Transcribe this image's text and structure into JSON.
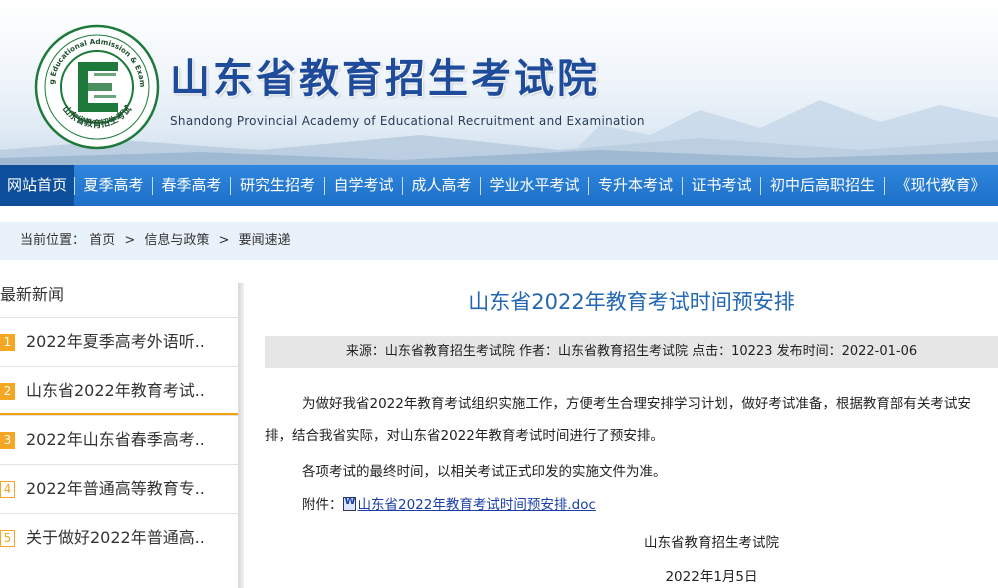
{
  "header": {
    "site_title": "山东省教育招生考试院",
    "site_subtitle": "Shandong Provincial Academy of Educational Recruitment and Examination",
    "logo_ring_text": "Shandong Educational Admission & Examinations",
    "logo_cn_text": "山东省教育招生考试"
  },
  "nav": {
    "items": [
      {
        "label": "网站首页",
        "active": true
      },
      {
        "label": "夏季高考"
      },
      {
        "label": "春季高考"
      },
      {
        "label": "研究生招考"
      },
      {
        "label": "自学考试"
      },
      {
        "label": "成人高考"
      },
      {
        "label": "学业水平考试"
      },
      {
        "label": "专升本考试"
      },
      {
        "label": "证书考试"
      },
      {
        "label": "初中后高职招生"
      },
      {
        "label": "《现代教育》"
      }
    ]
  },
  "breadcrumb": {
    "prefix": "当前位置：",
    "items": [
      "首页",
      "信息与政策",
      "要闻速递"
    ],
    "separator": ">"
  },
  "sidebar": {
    "heading": "最新新闻",
    "items": [
      {
        "num": "1",
        "text": "2022年夏季高考外语听.."
      },
      {
        "num": "2",
        "text": "山东省2022年教育考试.."
      },
      {
        "num": "3",
        "text": "2022年山东省春季高考.."
      },
      {
        "num": "4",
        "text": "2022年普通高等教育专.."
      },
      {
        "num": "5",
        "text": "关于做好2022年普通高.."
      }
    ]
  },
  "article": {
    "title": "山东省2022年教育考试时间预安排",
    "meta": "来源：山东省教育招生考试院 作者：山东省教育招生考试院 点击：10223 发布时间：2022-01-06",
    "paragraph1": "为做好我省2022年教育考试组织实施工作，方便考生合理安排学习计划，做好考试准备，根据教育部有关考试安排，结合我省实际，对山东省2022年教育考试时间进行了预安排。",
    "paragraph2": "各项考试的最终时间，以相关考试正式印发的实施文件为准。",
    "attachment_label": "附件：",
    "attachment_file": "山东省2022年教育考试时间预安排.doc",
    "signature_org": "山东省教育招生考试院",
    "signature_date": "2022年1月5日"
  },
  "colors": {
    "nav_bg": "#1d6fc7",
    "nav_active": "#0d4f9a",
    "title_blue": "#2367b3",
    "accent_orange": "#f5a623",
    "logo_green": "#1d7a3a"
  }
}
